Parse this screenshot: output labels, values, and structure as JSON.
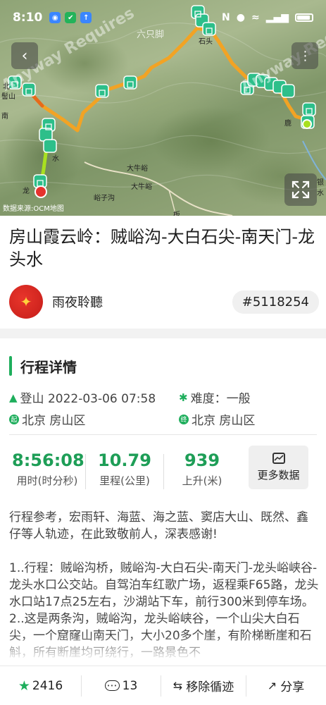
{
  "status_bar": {
    "time": "8:10",
    "icons": [
      "app-notification-icon",
      "app-green-icon",
      "app-upload-icon",
      "nfc-icon",
      "location-icon",
      "wifi-icon",
      "signal-icon",
      "battery-icon"
    ]
  },
  "map": {
    "watermark_left": "Anyway Requires",
    "watermark_right": "Anyway Requires",
    "brand": "六只脚",
    "attribution": "数据来源:OCM地图",
    "place_labels": [
      "北",
      "髻山",
      "南",
      "水",
      "龙",
      "大牛峪",
      "大牛峪",
      "峪子沟",
      "石头",
      "鹿",
      "板",
      "银水"
    ],
    "route_color": "#f2a324",
    "marker_color": "#2dbf8a",
    "back_icon": "back-arrow-icon",
    "more_icon": "more-dots-icon",
    "expand_icon": "expand-icon"
  },
  "trip": {
    "title": "房山霞云岭：贼峪沟-大白石尖-南天门-龙头水",
    "author": "雨夜聆聽",
    "trip_id": "#5118254"
  },
  "details": {
    "section_title": "行程详情",
    "activity_time": "登山 2022-03-06 07:58",
    "difficulty": "难度：一般",
    "start_place": "北京 房山区",
    "end_place": "北京 房山区",
    "start_badge": "起",
    "end_badge": "终"
  },
  "stats": {
    "duration_value": "8:56:08",
    "duration_label": "用时(时分秒)",
    "distance_value": "10.79",
    "distance_label": "里程(公里)",
    "ascent_value": "939",
    "ascent_label": "上升(米)",
    "more_label": "更多数据"
  },
  "description": {
    "para1": "行程参考，宏雨轩、海蓝、海之蓝、窦店大山、既然、鑫仔等人轨迹，在此致敬前人，深表感谢!",
    "para2": "1..行程：贼峪沟桥，贼峪沟-大白石尖-南天门-龙头峪峡谷-龙头水口公交站。自驾泊车红歌广场，返程乘F65路，龙头水口站17点25左右，沙湖站下车，前行300米到停车场。",
    "para3": "2..这是两条沟，贼峪沟，龙头峪峡谷，一个山尖大白石尖，一个窟窿山南天门，大小20多个崖，有阶梯断崖和石斛，所有断崖均可绕行，一路景色不"
  },
  "bottom_bar": {
    "likes": "2416",
    "comments": "13",
    "follow_label": "移除循迹",
    "share_label": "分享"
  },
  "colors": {
    "accent_green": "#1eae5c",
    "stat_green": "#1e9e57"
  }
}
